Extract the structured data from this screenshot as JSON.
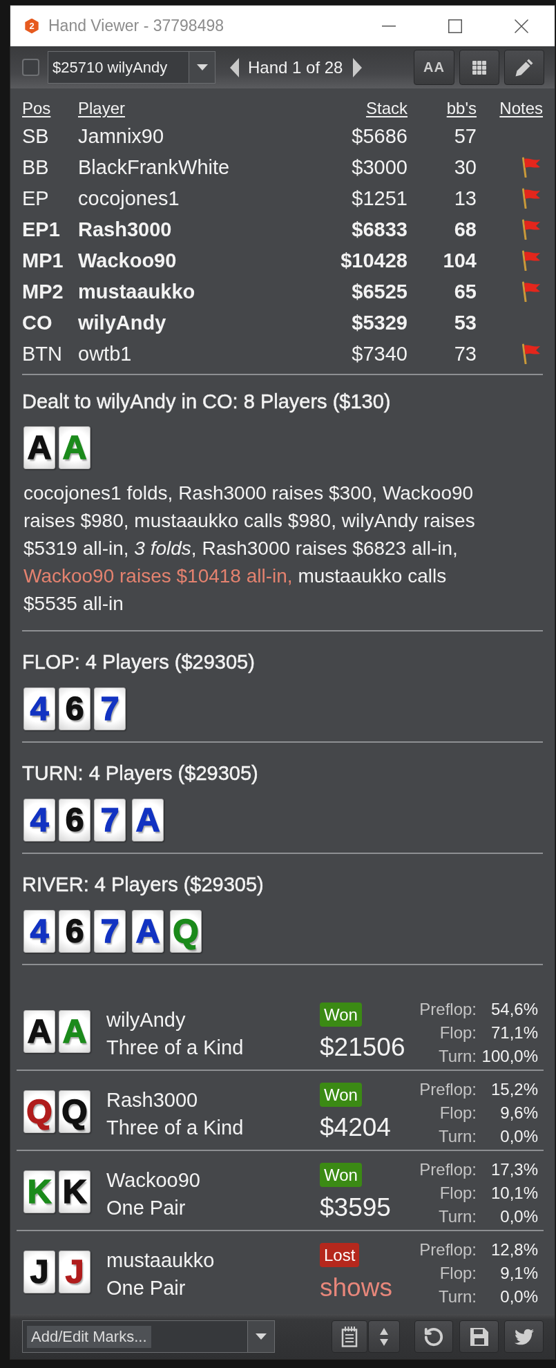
{
  "window": {
    "logo_label": "2",
    "title": "Hand Viewer - 37798498"
  },
  "toolbar": {
    "checkbox": {
      "checked": false
    },
    "player_select": {
      "value": "$25710 wilyAndy"
    },
    "hand_counter": "Hand 1 of 28",
    "font_button": "AA"
  },
  "players_table": {
    "columns": [
      "Pos",
      "Player",
      "Stack",
      "bb's",
      "Notes"
    ],
    "rows": [
      {
        "pos": "SB",
        "player": "Jamnix90",
        "stack": "$5686",
        "bb": "57",
        "bold": false,
        "has_note": false
      },
      {
        "pos": "BB",
        "player": "BlackFrankWhite",
        "stack": "$3000",
        "bb": "30",
        "bold": false,
        "has_note": true
      },
      {
        "pos": "EP",
        "player": "cocojones1",
        "stack": "$1251",
        "bb": "13",
        "bold": false,
        "has_note": true
      },
      {
        "pos": "EP1",
        "player": "Rash3000",
        "stack": "$6833",
        "bb": "68",
        "bold": true,
        "has_note": true
      },
      {
        "pos": "MP1",
        "player": "Wackoo90",
        "stack": "$10428",
        "bb": "104",
        "bold": true,
        "has_note": true
      },
      {
        "pos": "MP2",
        "player": "mustaaukko",
        "stack": "$6525",
        "bb": "65",
        "bold": true,
        "has_note": true
      },
      {
        "pos": "CO",
        "player": "wilyAndy",
        "stack": "$5329",
        "bb": "53",
        "bold": true,
        "has_note": false
      },
      {
        "pos": "BTN",
        "player": "owtb1",
        "stack": "$7340",
        "bb": "73",
        "bold": false,
        "has_note": true
      }
    ]
  },
  "preflop": {
    "heading": "Dealt to wilyAndy in CO: 8 Players ($130)",
    "hole_cards": [
      {
        "rank": "A",
        "color": "#111111"
      },
      {
        "rank": "A",
        "color": "#1b8a1b"
      }
    ],
    "actions": [
      {
        "text": "cocojones1 folds,",
        "highlighted": false
      },
      {
        "text": "Rash3000 raises $300,",
        "highlighted": false
      },
      {
        "text": "Wackoo90 raises $980,",
        "highlighted": false
      },
      {
        "text": "mustaaukko calls $980,",
        "highlighted": false
      },
      {
        "text": "wilyAndy raises $5319 all-in,",
        "highlighted": false
      },
      {
        "text": "*3 folds*,",
        "highlighted": false
      },
      {
        "text": "Rash3000 raises $6823 all-in,",
        "highlighted": false
      },
      {
        "text": "Wackoo90 raises $10418 all-in,",
        "highlighted": true
      },
      {
        "text": "mustaaukko calls $5535 all-in",
        "highlighted": false
      }
    ]
  },
  "streets": [
    {
      "heading": "FLOP: 4 Players ($29305)",
      "cards": [
        {
          "rank": "4",
          "color": "#1233c2"
        },
        {
          "rank": "6",
          "color": "#111111"
        },
        {
          "rank": "7",
          "color": "#1233c2"
        }
      ]
    },
    {
      "heading": "TURN: 4 Players ($29305)",
      "cards": [
        {
          "rank": "4",
          "color": "#1233c2"
        },
        {
          "rank": "6",
          "color": "#111111"
        },
        {
          "rank": "7",
          "color": "#1233c2"
        },
        {
          "rank": "A",
          "color": "#1233c2"
        }
      ]
    },
    {
      "heading": "RIVER: 4 Players ($29305)",
      "cards": [
        {
          "rank": "4",
          "color": "#1233c2"
        },
        {
          "rank": "6",
          "color": "#111111"
        },
        {
          "rank": "7",
          "color": "#1233c2"
        },
        {
          "rank": "A",
          "color": "#1233c2"
        },
        {
          "rank": "Q",
          "color": "#1b8a1b"
        }
      ]
    }
  ],
  "results": [
    {
      "cards": [
        {
          "rank": "A",
          "color": "#111111"
        },
        {
          "rank": "A",
          "color": "#1b8a1b"
        }
      ],
      "player": "wilyAndy",
      "hand": "Three of a Kind",
      "status": {
        "label": "Won",
        "kind": "won"
      },
      "amount": "$21506",
      "equity": [
        {
          "label": "Preflop:",
          "value": "54,6%"
        },
        {
          "label": "Flop:",
          "value": "71,1%"
        },
        {
          "label": "Turn:",
          "value": "100,0%"
        }
      ]
    },
    {
      "cards": [
        {
          "rank": "Q",
          "color": "#b01c1c"
        },
        {
          "rank": "Q",
          "color": "#111111"
        }
      ],
      "player": "Rash3000",
      "hand": "Three of a Kind",
      "status": {
        "label": "Won",
        "kind": "won"
      },
      "amount": "$4204",
      "equity": [
        {
          "label": "Preflop:",
          "value": "15,2%"
        },
        {
          "label": "Flop:",
          "value": "9,6%"
        },
        {
          "label": "Turn:",
          "value": "0,0%"
        }
      ]
    },
    {
      "cards": [
        {
          "rank": "K",
          "color": "#1b8a1b"
        },
        {
          "rank": "K",
          "color": "#111111"
        }
      ],
      "player": "Wackoo90",
      "hand": "One Pair",
      "status": {
        "label": "Won",
        "kind": "won"
      },
      "amount": "$3595",
      "equity": [
        {
          "label": "Preflop:",
          "value": "17,3%"
        },
        {
          "label": "Flop:",
          "value": "10,1%"
        },
        {
          "label": "Turn:",
          "value": "0,0%"
        }
      ]
    },
    {
      "cards": [
        {
          "rank": "J",
          "color": "#111111"
        },
        {
          "rank": "J",
          "color": "#b01c1c"
        }
      ],
      "player": "mustaaukko",
      "hand": "One Pair",
      "status": {
        "label": "Lost",
        "kind": "lost"
      },
      "amount": "shows",
      "equity": [
        {
          "label": "Preflop:",
          "value": "12,8%"
        },
        {
          "label": "Flop:",
          "value": "9,1%"
        },
        {
          "label": "Turn:",
          "value": "0,0%"
        }
      ]
    }
  ],
  "footer": {
    "marks_select": {
      "value": "Add/Edit Marks..."
    }
  }
}
